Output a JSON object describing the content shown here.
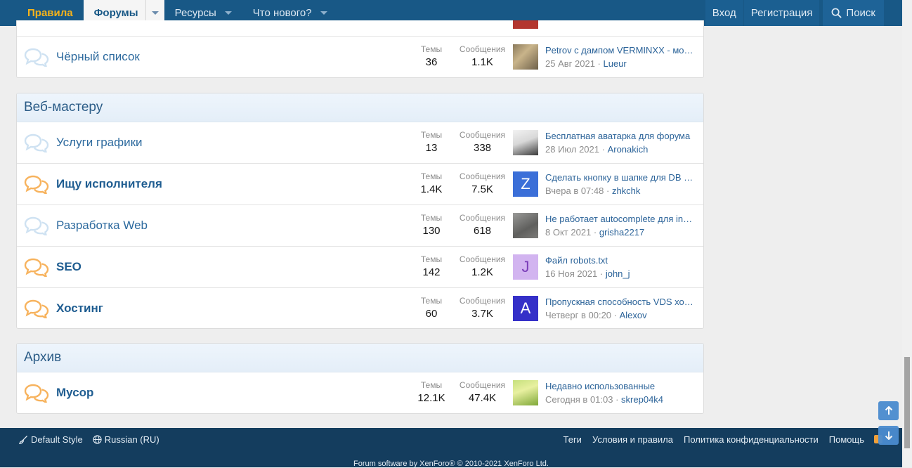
{
  "nav": {
    "rules": "Правила",
    "forums": "Форумы",
    "resources": "Ресурсы",
    "whats_new": "Что нового?",
    "login": "Вход",
    "register": "Регистрация",
    "search": "Поиск"
  },
  "labels": {
    "threads": "Темы",
    "posts": "Сообщения"
  },
  "top_node": {
    "title": "Чёрный список",
    "threads": "36",
    "posts": "1.1K",
    "last_title": "Petrov с дампом VERMINXX - мошенник",
    "last_date": "25 Авг 2021",
    "last_user": "Lueur"
  },
  "webmaster": {
    "header": "Веб-мастеру",
    "nodes": [
      {
        "title": "Услуги графики",
        "threads": "13",
        "posts": "338",
        "last_title": "Бесплатная аватарка для форума",
        "last_date": "28 Июл 2021",
        "last_user": "Aronakich",
        "avatar_letter": ""
      },
      {
        "title": "Ищу исполнителя",
        "threads": "1.4K",
        "posts": "7.5K",
        "last_title": "Сделать кнопку в шапке для DB Core",
        "last_date": "Вчера в 07:48",
        "last_user": "zhkchk",
        "avatar_letter": "Z"
      },
      {
        "title": "Разработка Web",
        "threads": "130",
        "posts": "618",
        "last_title": "Не работает autocomplete для input",
        "last_date": "8 Окт 2021",
        "last_user": "grisha2217",
        "avatar_letter": ""
      },
      {
        "title": "SEO",
        "threads": "142",
        "posts": "1.2K",
        "last_title": "Файл robots.txt",
        "last_date": "16 Ноя 2021",
        "last_user": "john_j",
        "avatar_letter": "J"
      },
      {
        "title": "Хостинг",
        "threads": "60",
        "posts": "3.7K",
        "last_title": "Пропускная способность VDS хостинга",
        "last_date": "Четверг в 00:20",
        "last_user": "Alexov",
        "avatar_letter": "A"
      }
    ]
  },
  "archive": {
    "header": "Архив",
    "nodes": [
      {
        "title": "Мусор",
        "threads": "12.1K",
        "posts": "47.4K",
        "last_title": "Недавно использованные",
        "last_date": "Сегодня в 01:03",
        "last_user": "skrep04k4"
      }
    ]
  },
  "footer": {
    "style": "Default Style",
    "language": "Russian (RU)",
    "tags": "Теги",
    "terms": "Условия и правила",
    "privacy": "Политика конфиденциальности",
    "help": "Помощь",
    "copyright": "Forum software by XenForo® © 2010-2021 XenForo Ltd."
  },
  "colors": {
    "nav": "#185886",
    "footer": "#143d5e",
    "unread_icon": "#f7b35e",
    "read_icon": "#cfe2f2"
  }
}
